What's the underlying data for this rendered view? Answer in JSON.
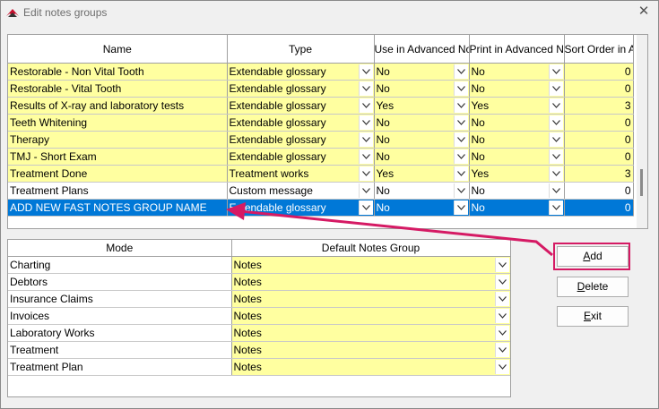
{
  "window": {
    "title": "Edit notes groups",
    "close_symbol": "✕"
  },
  "notes_groups": {
    "columns": [
      "Name",
      "Type",
      "Use in Advanced Notes",
      "Print in Advanced Notes",
      "Sort Order in Adv. Notes"
    ],
    "rows": [
      {
        "name": "Restorable - Non Vital Tooth",
        "type": "Extendable glossary",
        "use": "No",
        "print": "No",
        "sort": "0",
        "style": "yellow"
      },
      {
        "name": "Restorable - Vital Tooth",
        "type": "Extendable glossary",
        "use": "No",
        "print": "No",
        "sort": "0",
        "style": "yellow"
      },
      {
        "name": "Results of X-ray and laboratory tests",
        "type": "Extendable glossary",
        "use": "Yes",
        "print": "Yes",
        "sort": "3",
        "style": "yellow"
      },
      {
        "name": "Teeth Whitening",
        "type": "Extendable glossary",
        "use": "No",
        "print": "No",
        "sort": "0",
        "style": "yellow"
      },
      {
        "name": "Therapy",
        "type": "Extendable glossary",
        "use": "No",
        "print": "No",
        "sort": "0",
        "style": "yellow"
      },
      {
        "name": "TMJ - Short Exam",
        "type": "Extendable glossary",
        "use": "No",
        "print": "No",
        "sort": "0",
        "style": "yellow"
      },
      {
        "name": "Treatment Done",
        "type": "Treatment works",
        "use": "Yes",
        "print": "Yes",
        "sort": "3",
        "style": "yellow"
      },
      {
        "name": "Treatment Plans",
        "type": "Custom message",
        "use": "No",
        "print": "No",
        "sort": "0",
        "style": "white"
      },
      {
        "name": "ADD NEW FAST NOTES GROUP NAME",
        "type": "Extendable glossary",
        "use": "No",
        "print": "No",
        "sort": "0",
        "style": "selected"
      }
    ]
  },
  "mode_grid": {
    "columns": [
      "Mode",
      "Default Notes Group"
    ],
    "rows": [
      {
        "mode": "Charting",
        "group": "Notes"
      },
      {
        "mode": "Debtors",
        "group": "Notes"
      },
      {
        "mode": "Insurance Claims",
        "group": "Notes"
      },
      {
        "mode": "Invoices",
        "group": "Notes"
      },
      {
        "mode": "Laboratory Works",
        "group": "Notes"
      },
      {
        "mode": "Treatment",
        "group": "Notes"
      },
      {
        "mode": "Treatment Plan",
        "group": "Notes"
      }
    ]
  },
  "buttons": {
    "add": {
      "first": "A",
      "rest": "dd"
    },
    "delete": {
      "first": "D",
      "rest": "elete"
    },
    "exit": {
      "first": "E",
      "rest": "xit"
    }
  },
  "colors": {
    "row_yellow": "#ffffa0",
    "selection": "#0078d7",
    "annotation": "#d51a64"
  }
}
